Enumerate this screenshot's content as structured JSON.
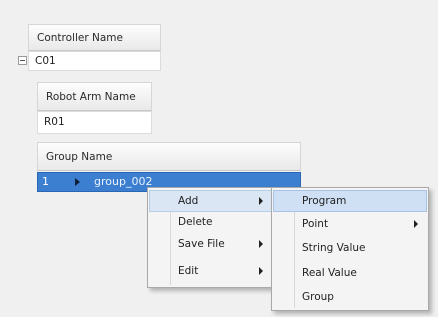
{
  "controller": {
    "header": "Controller Name",
    "value": "C01"
  },
  "robot_arm": {
    "header": "Robot Arm Name",
    "value": "R01"
  },
  "group": {
    "header": "Group Name",
    "row_index": "1",
    "row_value": "group_002"
  },
  "context_menu": {
    "items": [
      {
        "label": "Add",
        "has_submenu": true
      },
      {
        "label": "Delete",
        "has_submenu": false
      },
      {
        "label": "Save File",
        "has_submenu": true
      },
      {
        "label": "Edit",
        "has_submenu": true
      }
    ]
  },
  "add_submenu": {
    "items": [
      {
        "label": "Program",
        "has_submenu": false
      },
      {
        "label": "Point",
        "has_submenu": true
      },
      {
        "label": "String Value",
        "has_submenu": false
      },
      {
        "label": "Real Value",
        "has_submenu": false
      },
      {
        "label": "Group",
        "has_submenu": false
      }
    ]
  }
}
